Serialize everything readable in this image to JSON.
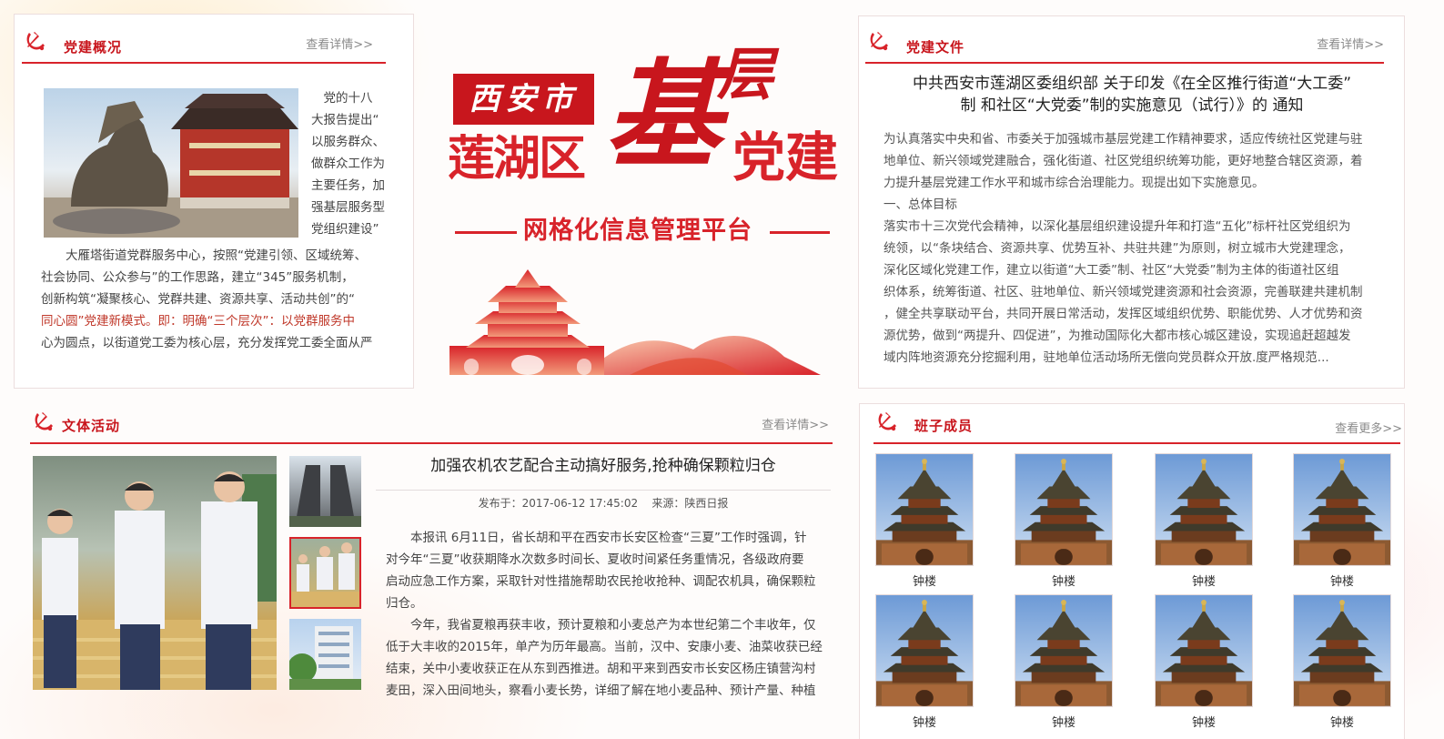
{
  "party_overview": {
    "title": "党建概况",
    "more": "查看详情>>",
    "intro_lines": [
      "党的十八",
      "大报告提出“",
      "以服务群众、",
      "做群众工作为",
      "主要任务，加",
      "强基层服务型",
      "党组织建设”"
    ],
    "para_lines": [
      "大雁塔街道党群服务中心，按照“党建引领、区域统筹、",
      "社会协同、公众参与”的工作思路，建立“345”服务机制，",
      "创新构筑“凝聚核心、党群共建、资源共享、活动共创”的“",
      "同心圆”党建新模式。即：明确“三个层次”：以党群服务中",
      "心为圆点，以街道党工委为核心层，充分发挥党工委全面从严"
    ]
  },
  "banner": {
    "city": "西安市",
    "district": "莲湖区",
    "char1": "基",
    "char2": "层",
    "party": "党建",
    "subtitle": "网格化信息管理平台"
  },
  "party_docs": {
    "title": "党建文件",
    "more": "查看详情>>",
    "doc_title_1": "中共西安市莲湖区委组织部 关于印发《在全区推行街道“大工委”",
    "doc_title_2": "制 和社区“大党委”制的实施意见（试行）》的 通知",
    "body_lines": [
      "为认真落实中央和省、市委关于加强城市基层党建工作精神要求，适应传统社区党建与驻",
      "地单位、新兴领域党建融合，强化街道、社区党组织统筹功能，更好地整合辖区资源，着",
      "力提升基层党建工作水平和城市综合治理能力。现提出如下实施意见。",
      "一、总体目标",
      "落实市十三次党代会精神，以深化基层组织建设提升年和打造“五化”标杆社区党组织为",
      "统领，以“条块结合、资源共享、优势互补、共驻共建”为原则，树立城市大党建理念，",
      "深化区域化党建工作，建立以街道“大工委”制、社区“大党委”制为主体的街道社区组",
      "织体系，统筹街道、社区、驻地单位、新兴领域党建资源和社会资源，完善联建共建机制",
      "，健全共享联动平台，共同开展日常活动，发挥区域组织优势、职能优势、人才优势和资",
      "源优势，做到“两提升、四促进”，为推动国际化大都市核心城区建设，实现追赶超越发",
      "域内阵地资源充分挖掘利用，驻地单位活动场所无偿向党员群众开放.度严格规范..."
    ]
  },
  "culture": {
    "title": "文体活动",
    "more": "查看详情>>",
    "article_title": "加强农机农艺配合主动搞好服务,抢种确保颗粒归仓",
    "meta": "发布于：2017-06-12 17:45:02    来源：陕西日报",
    "body_lines": [
      "本报讯 6月11日，省长胡和平在西安市长安区检查“三夏”工作时强调，针",
      "对今年“三夏”收获期降水次数多时间长、夏收时间紧任务重情况，各级政府要",
      "启动应急工作方案，采取针对性措施帮助农民抢收抢种、调配农机具，确保颗粒",
      "归仓。",
      "今年，我省夏粮再获丰收，预计夏粮和小麦总产为本世纪第二个丰收年，仅",
      "低于大丰收的2015年，单产为历年最高。当前，汉中、安康小麦、油菜收获已经",
      "结束，关中小麦收获正在从东到西推进。胡和平来到西安市长安区杨庄镇营沟村",
      "麦田，深入田间地头，察看小麦长势，详细了解在地小麦品种、预计产量、种植"
    ]
  },
  "members": {
    "title": "班子成员",
    "more": "查看更多>>",
    "items": [
      {
        "name": "钟楼"
      },
      {
        "name": "钟楼"
      },
      {
        "name": "钟楼"
      },
      {
        "name": "钟楼"
      },
      {
        "name": "钟楼"
      },
      {
        "name": "钟楼"
      },
      {
        "name": "钟楼"
      },
      {
        "name": "钟楼"
      }
    ]
  },
  "colors": {
    "accent": "#d8232a",
    "heading": "#c8161d"
  }
}
